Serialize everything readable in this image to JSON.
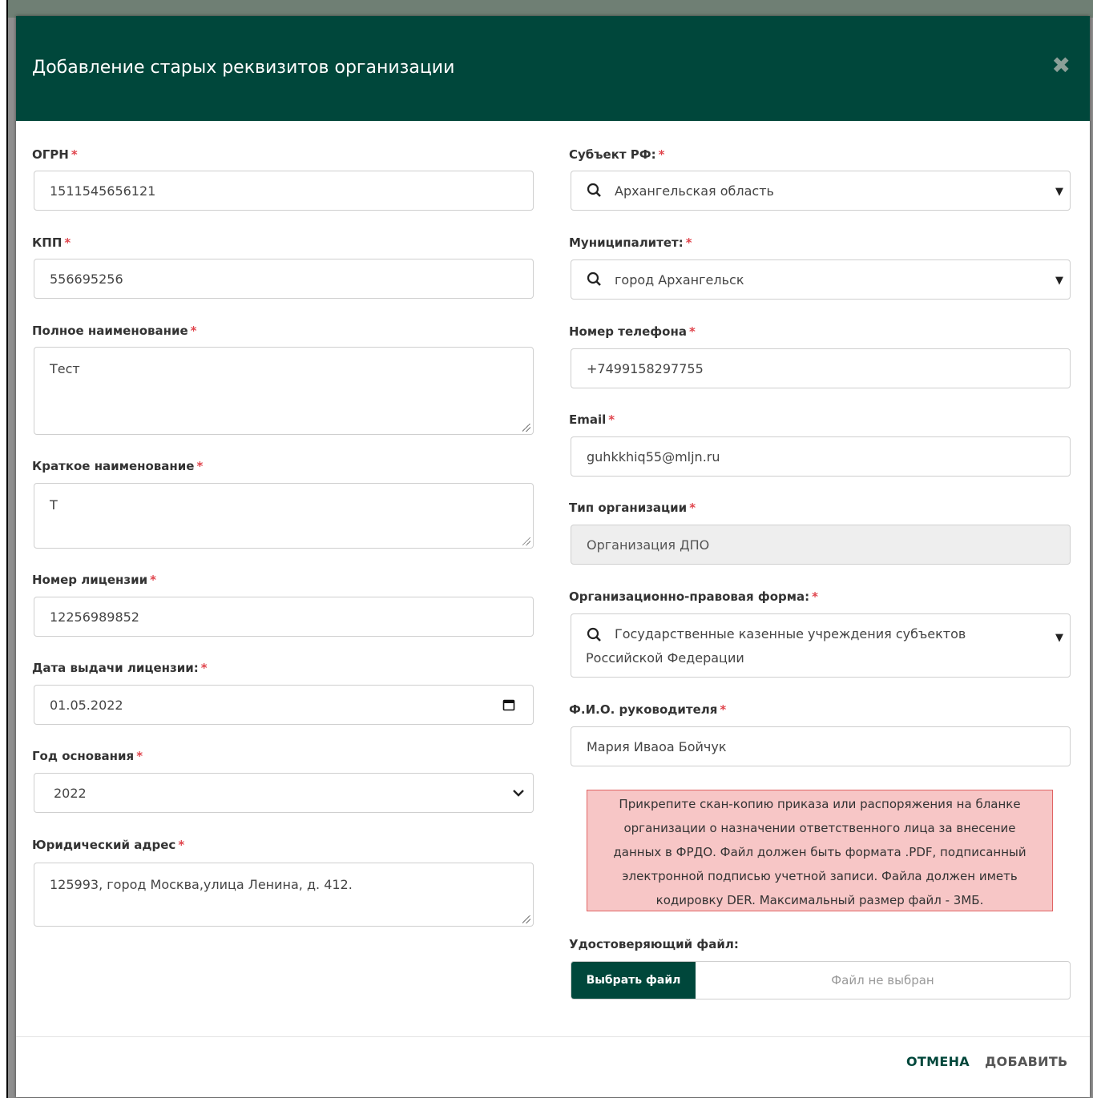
{
  "dialog": {
    "title": "Добавление старых реквизитов организации",
    "close_icon": "✖"
  },
  "required_mark": "*",
  "left": {
    "ogrn": {
      "label": "ОГРН",
      "value": "1511545656121"
    },
    "kpp": {
      "label": "КПП",
      "value": "556695256"
    },
    "full_name": {
      "label": "Полное наименование",
      "value": "Тест"
    },
    "short_name": {
      "label": "Краткое наименование",
      "value": "Т"
    },
    "license_number": {
      "label": "Номер лицензии",
      "value": "12256989852"
    },
    "license_date": {
      "label": "Дата выдачи лицензии:",
      "value": "01.05.2022"
    },
    "founded_year": {
      "label": "Год основания",
      "value": "2022"
    },
    "legal_address": {
      "label": "Юридический адрес",
      "value": "125993, город Москва,улица Ленина, д. 412."
    }
  },
  "right": {
    "region": {
      "label": "Субъект РФ:",
      "value": "Архангельская область"
    },
    "municipality": {
      "label": "Муниципалитет:",
      "value": "город Архангельск"
    },
    "phone": {
      "label": "Номер телефона",
      "value": "+7499158297755"
    },
    "email": {
      "label": "Email",
      "value": "guhkkhiq55@mljn.ru"
    },
    "org_type": {
      "label": "Тип организации",
      "value": "Организация ДПО"
    },
    "legal_form": {
      "label": "Организационно-правовая форма:",
      "value_line1": "Государственные казенные учреждения субъектов",
      "value_line2": "Российской Федерации"
    },
    "head_name": {
      "label": "Ф.И.О. руководителя",
      "value": "Мария Иваоа Бойчук"
    }
  },
  "notice": {
    "lines": [
      "Прикрепите скан-копию приказа или распоряжения на бланке",
      "организации о назначении ответственного лица за внесение",
      "данных в ФРДО. Файл должен быть формата .PDF, подписанный",
      "электронной подписью учетной записи. Файла должен иметь",
      "кодировку DER. Максимальный размер файл - 3МБ."
    ],
    "bg_color": "#f7c6c6"
  },
  "file_upload": {
    "label": "Удостоверяющий файл:",
    "button": "Выбрать файл",
    "status": "Файл не выбран"
  },
  "footer": {
    "cancel": "ОТМЕНА",
    "add": "ДОБАВИТЬ"
  },
  "colors": {
    "header_bg": "#00473b",
    "required": "#e0454d",
    "cancel_text": "#00473b",
    "add_text": "#555555"
  }
}
